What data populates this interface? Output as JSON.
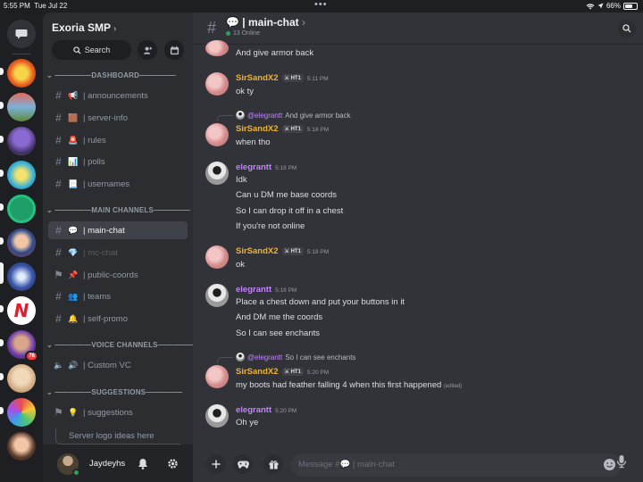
{
  "status_bar": {
    "time": "5:55 PM",
    "date": "Tue Jul 22",
    "battery": "66%",
    "battery_level": 0.66
  },
  "rail": {
    "dm_icon": "chat-bubble-icon",
    "badge": "76"
  },
  "server": {
    "name": "Exoria SMP",
    "search_label": "Search"
  },
  "categories": {
    "dashboard": "—————DASHBOARD—————",
    "main": "—————MAIN CHANNELS—————",
    "voice": "—————VOICE CHANNELS—————",
    "suggestions": "—————SUGGESTIONS—————"
  },
  "channels": [
    {
      "name": "| announcements",
      "emoji": "📢"
    },
    {
      "name": "| server-info",
      "emoji": "🟫"
    },
    {
      "name": "| rules",
      "emoji": "🚨"
    },
    {
      "name": "| polls",
      "emoji": "📊"
    },
    {
      "name": "| usernames",
      "emoji": "📃"
    },
    {
      "name": "| main-chat",
      "emoji": "💬"
    },
    {
      "name": "| mc-chat",
      "emoji": "💎"
    },
    {
      "name": "| public-coords",
      "emoji": "📌"
    },
    {
      "name": "| teams",
      "emoji": "👥"
    },
    {
      "name": "| self-promo",
      "emoji": "🔔"
    },
    {
      "name": "| Custom VC",
      "emoji": "🔊"
    },
    {
      "name": "| suggestions",
      "emoji": "💡"
    }
  ],
  "thread": {
    "label": "Server logo ideas here"
  },
  "user": {
    "name": "Jaydeyhs"
  },
  "chat": {
    "emoji": "💬",
    "title": "| main-chat",
    "online": "13 Online",
    "placeholder": "Message #💬 | main-chat"
  },
  "messages": {
    "m0": {
      "text": "And give armor back"
    },
    "m1": {
      "author": "SirSandX2",
      "tag": "HT1",
      "time": "5:11 PM",
      "lines": [
        "ok ty"
      ]
    },
    "m2": {
      "reply_author": "@elegrantt",
      "reply_text": "And give armor back",
      "author": "SirSandX2",
      "tag": "HT1",
      "time": "5:18 PM",
      "lines": [
        "when tho"
      ]
    },
    "m3": {
      "author": "elegrantt",
      "time": "5:18 PM",
      "lines": [
        "Idk",
        "Can u DM me base coords",
        "So I can drop it off in a chest",
        "If you're not online"
      ]
    },
    "m4": {
      "author": "SirSandX2",
      "tag": "HT1",
      "time": "5:18 PM",
      "lines": [
        "ok"
      ]
    },
    "m5": {
      "author": "elegrantt",
      "time": "5:18 PM",
      "lines": [
        "Place a chest down and put your buttons in it",
        "And DM me the coords",
        "So I can see enchants"
      ]
    },
    "m6": {
      "reply_author": "@elegrantt",
      "reply_text": "So I can see enchants",
      "author": "SirSandX2",
      "tag": "HT1",
      "time": "5:20 PM",
      "lines": [
        "my boots had feather falling 4 when this first happened"
      ],
      "edited": "(edited)"
    },
    "m7": {
      "author": "elegrantt",
      "time": "5:20 PM",
      "lines": [
        "Oh ye"
      ]
    }
  },
  "colors": {
    "sir_name": "#f0b232",
    "elegrantt_name": "#c084fc",
    "online": "#23a55a",
    "mention_badge": "#f23f43"
  }
}
